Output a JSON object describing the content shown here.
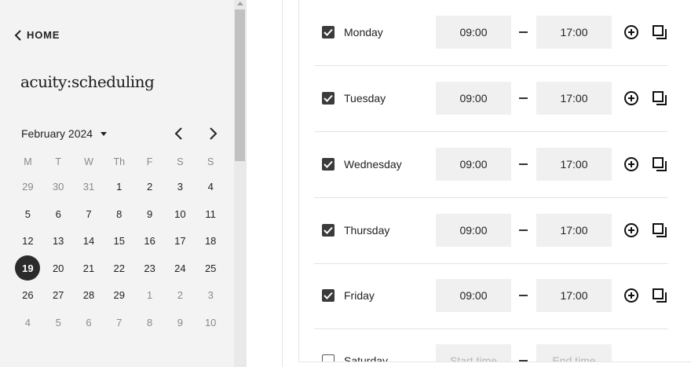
{
  "sidebar": {
    "home_label": "HOME",
    "logo_text": "acuity:scheduling",
    "month_label": "February 2024",
    "weekdays": [
      "M",
      "T",
      "W",
      "Th",
      "F",
      "S",
      "S"
    ],
    "weeks": [
      [
        "29",
        "30",
        "31",
        "1",
        "2",
        "3",
        "4"
      ],
      [
        "5",
        "6",
        "7",
        "8",
        "9",
        "10",
        "11"
      ],
      [
        "12",
        "13",
        "14",
        "15",
        "16",
        "17",
        "18"
      ],
      [
        "19",
        "20",
        "21",
        "22",
        "23",
        "24",
        "25"
      ],
      [
        "26",
        "27",
        "28",
        "29",
        "1",
        "2",
        "3"
      ],
      [
        "4",
        "5",
        "6",
        "7",
        "8",
        "9",
        "10"
      ]
    ],
    "selected_date": "19"
  },
  "schedule": {
    "days": [
      {
        "label": "Monday",
        "checked": true,
        "start": "09:00",
        "end": "17:00"
      },
      {
        "label": "Tuesday",
        "checked": true,
        "start": "09:00",
        "end": "17:00"
      },
      {
        "label": "Wednesday",
        "checked": true,
        "start": "09:00",
        "end": "17:00"
      },
      {
        "label": "Thursday",
        "checked": true,
        "start": "09:00",
        "end": "17:00"
      },
      {
        "label": "Friday",
        "checked": true,
        "start": "09:00",
        "end": "17:00"
      },
      {
        "label": "Saturday",
        "checked": false,
        "start_placeholder": "Start time",
        "end_placeholder": "End time"
      }
    ]
  },
  "icons": {
    "home_back": "chevron-left-icon",
    "prev_month": "chevron-left-icon",
    "next_month": "chevron-right-icon",
    "month_dropdown": "caret-down-icon",
    "add_interval": "plus-circle-icon",
    "copy_times": "copy-icon",
    "checkbox_checked": "check-icon"
  },
  "colors": {
    "sidebar_bg": "#f3f3f3",
    "selected_day_bg": "#2b2b2b",
    "checkbox_fill": "#3b3b3b",
    "time_field_bg": "#f0f0f0"
  }
}
